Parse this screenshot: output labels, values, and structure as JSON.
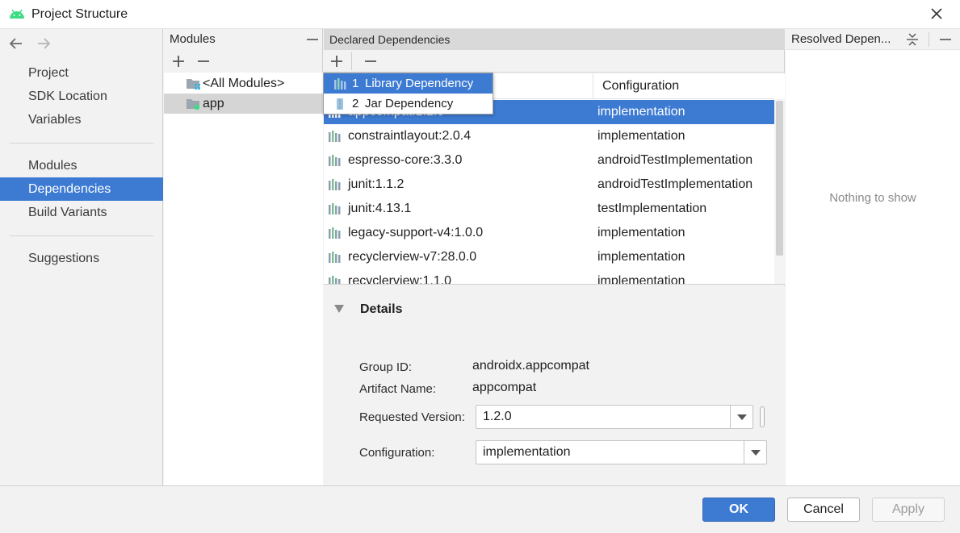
{
  "window": {
    "title": "Project Structure",
    "icon": "android-icon",
    "accent_color": "#3d7bd3"
  },
  "nav": {
    "back_icon": "arrow-left-icon",
    "forward_icon": "arrow-right-icon",
    "groups": [
      [
        "Project",
        "SDK Location",
        "Variables"
      ],
      [
        "Modules",
        "Dependencies",
        "Build Variants"
      ],
      [
        "Suggestions"
      ]
    ],
    "items": {
      "project": "Project",
      "sdk_location": "SDK Location",
      "variables": "Variables",
      "modules": "Modules",
      "dependencies": "Dependencies",
      "build_variants": "Build Variants",
      "suggestions": "Suggestions"
    },
    "selected": "Dependencies"
  },
  "modules_panel": {
    "title": "Modules",
    "items": [
      "<All Modules>",
      "app"
    ],
    "selected": "app"
  },
  "declared": {
    "title": "Declared Dependencies",
    "columns": [
      "",
      "Configuration"
    ],
    "rows": [
      {
        "name": "appcompat:1.2.0",
        "configuration": "implementation"
      },
      {
        "name": "constraintlayout:2.0.4",
        "configuration": "implementation"
      },
      {
        "name": "espresso-core:3.3.0",
        "configuration": "androidTestImplementation"
      },
      {
        "name": "junit:1.1.2",
        "configuration": "androidTestImplementation"
      },
      {
        "name": "junit:4.13.1",
        "configuration": "testImplementation"
      },
      {
        "name": "legacy-support-v4:1.0.0",
        "configuration": "implementation"
      },
      {
        "name": "recyclerview-v7:28.0.0",
        "configuration": "implementation"
      },
      {
        "name": "recyclerview:1.1.0",
        "configuration": "implementation"
      }
    ],
    "selected_row": "appcompat:1.2.0"
  },
  "add_menu": {
    "items": [
      {
        "key": "1",
        "label": "Library Dependency",
        "icon": "library-icon"
      },
      {
        "key": "2",
        "label": "Jar Dependency",
        "icon": "jar-icon"
      }
    ]
  },
  "details": {
    "title": "Details",
    "group_id_label": "Group ID:",
    "group_id": "androidx.appcompat",
    "artifact_label": "Artifact Name:",
    "artifact": "appcompat",
    "version_label": "Requested Version:",
    "version": "1.2.0",
    "configuration_label": "Configuration:",
    "configuration": "implementation"
  },
  "resolved": {
    "title": "Resolved Depen...",
    "empty_text": "Nothing to show"
  },
  "footer": {
    "ok": "OK",
    "cancel": "Cancel",
    "apply": "Apply"
  }
}
